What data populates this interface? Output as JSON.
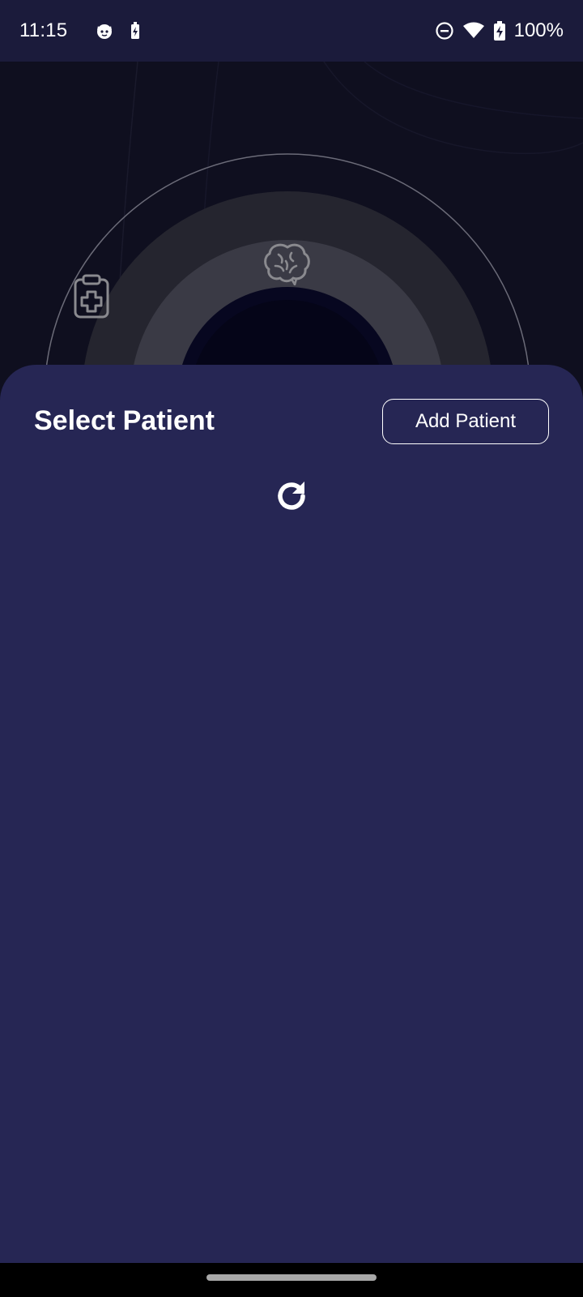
{
  "status_bar": {
    "time": "11:15",
    "battery_percent": "100%",
    "icons_left": [
      "cat-notification-icon",
      "battery-saver-icon"
    ],
    "icons_right": [
      "do-not-disturb-icon",
      "wifi-icon",
      "battery-charging-icon"
    ]
  },
  "hero": {
    "icons": [
      "clipboard-medical-icon",
      "brain-icon"
    ]
  },
  "sheet": {
    "title": "Select Patient",
    "add_button_label": "Add Patient",
    "refresh_icon": "refresh-icon"
  },
  "colors": {
    "status_bar_bg": "#1b1b3b",
    "background": "#0f0f1f",
    "sheet_bg": "#262654",
    "accent_text": "#ffffff"
  }
}
